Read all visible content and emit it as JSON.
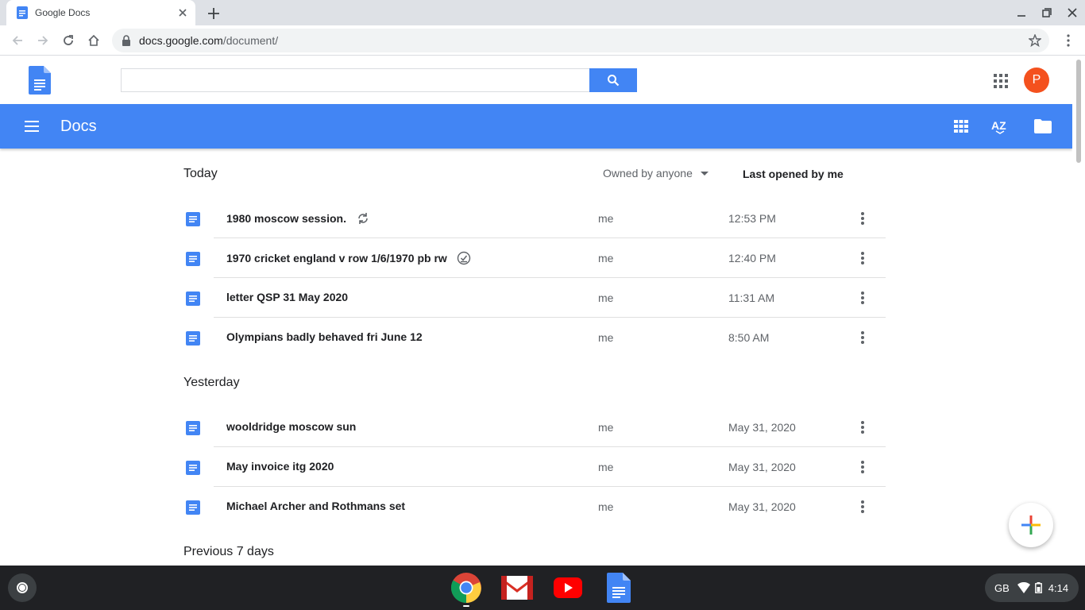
{
  "browser": {
    "tab_title": "Google Docs",
    "url_host": "docs.google.com",
    "url_path": "/document/"
  },
  "header": {
    "search_placeholder": "",
    "avatar_initial": "P"
  },
  "bar": {
    "title": "Docs"
  },
  "filters": {
    "owner_filter": "Owned by anyone",
    "sort": "Last opened by me"
  },
  "sections": [
    {
      "title": "Today",
      "docs": [
        {
          "name": "1980 moscow session.",
          "owner": "me",
          "date": "12:53 PM",
          "badge": "sync-icon"
        },
        {
          "name": "1970 cricket england v row 1/6/1970 pb rw",
          "owner": "me",
          "date": "12:40 PM",
          "badge": "offline-check-icon"
        },
        {
          "name": "letter QSP 31 May 2020",
          "owner": "me",
          "date": "11:31 AM"
        },
        {
          "name": "Olympians badly behaved fri June 12",
          "owner": "me",
          "date": "8:50 AM"
        }
      ]
    },
    {
      "title": "Yesterday",
      "docs": [
        {
          "name": "wooldridge moscow sun",
          "owner": "me",
          "date": "May 31, 2020"
        },
        {
          "name": "May invoice itg 2020",
          "owner": "me",
          "date": "May 31, 2020"
        },
        {
          "name": "Michael Archer and Rothmans set",
          "owner": "me",
          "date": "May 31, 2020"
        }
      ]
    },
    {
      "title": "Previous 7 days",
      "docs": []
    }
  ],
  "shelf": {
    "tray_locale": "GB",
    "time": "4:14"
  },
  "colors": {
    "brand_blue": "#4285f4",
    "avatar": "#f4511e"
  }
}
